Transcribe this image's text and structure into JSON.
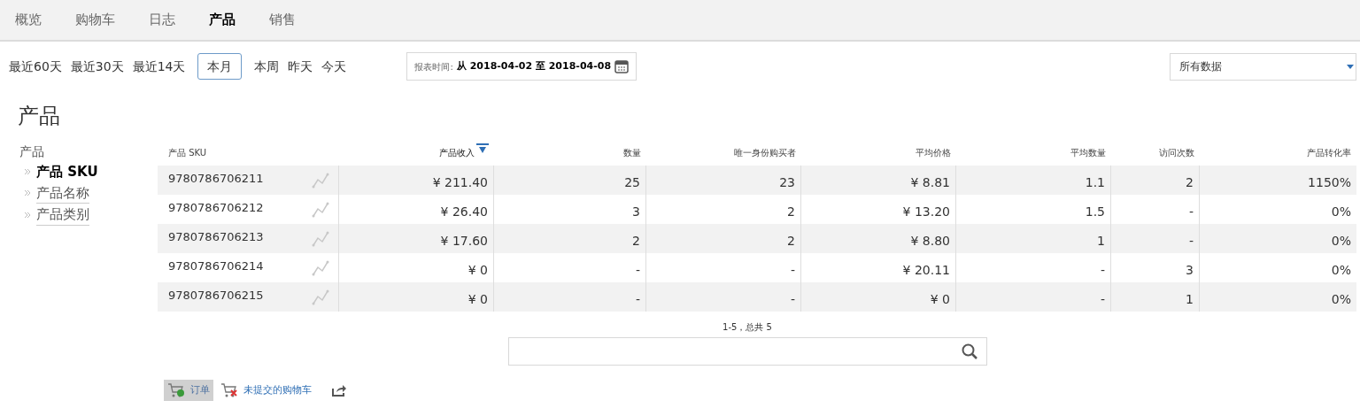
{
  "nav_tabs": [
    {
      "label": "概览",
      "selected": false
    },
    {
      "label": "购物车",
      "selected": false
    },
    {
      "label": "日志",
      "selected": false
    },
    {
      "label": "产品",
      "selected": true
    },
    {
      "label": "销售",
      "selected": false
    }
  ],
  "periods": [
    {
      "label": "最近60天",
      "selected": false
    },
    {
      "label": "最近30天",
      "selected": false
    },
    {
      "label": "最近14天",
      "selected": false
    },
    {
      "label": "本月",
      "selected": true
    },
    {
      "label": "本周",
      "selected": false
    },
    {
      "label": "昨天",
      "selected": false
    },
    {
      "label": "今天",
      "selected": false
    }
  ],
  "report_range": {
    "label": "报表时间:",
    "value": "从 2018-04-02 至 2018-04-08"
  },
  "segment_select": {
    "value": "所有数据"
  },
  "page_title": "产品",
  "sidebar": {
    "heading": "产品",
    "items": [
      {
        "label": "产品 SKU",
        "selected": true
      },
      {
        "label": "产品名称",
        "selected": false
      },
      {
        "label": "产品类别",
        "selected": false
      }
    ]
  },
  "table": {
    "columns": [
      {
        "label": "产品 SKU",
        "sorted": false
      },
      {
        "label": "产品收入",
        "sorted": true
      },
      {
        "label": "数量",
        "sorted": false
      },
      {
        "label": "唯一身份购买者",
        "sorted": false
      },
      {
        "label": "平均价格",
        "sorted": false
      },
      {
        "label": "平均数量",
        "sorted": false
      },
      {
        "label": "访问次数",
        "sorted": false
      },
      {
        "label": "产品转化率",
        "sorted": false
      }
    ],
    "rows": [
      [
        "9780786706211",
        "¥ 211.40",
        "25",
        "23",
        "¥ 8.81",
        "1.1",
        "2",
        "1150%"
      ],
      [
        "9780786706212",
        "¥ 26.40",
        "3",
        "2",
        "¥ 13.20",
        "1.5",
        "-",
        "0%"
      ],
      [
        "9780786706213",
        "¥ 17.60",
        "2",
        "2",
        "¥ 8.80",
        "1",
        "-",
        "0%"
      ],
      [
        "9780786706214",
        "¥ 0",
        "-",
        "-",
        "¥ 20.11",
        "-",
        "3",
        "0%"
      ],
      [
        "9780786706215",
        "¥ 0",
        "-",
        "-",
        "¥ 0",
        "-",
        "1",
        "0%"
      ]
    ]
  },
  "pagination": "1-5，总共 5",
  "bottom_tabs": [
    {
      "label": "订单",
      "kind": "orders",
      "selected": true
    },
    {
      "label": "未提交的购物车",
      "kind": "abandoned",
      "selected": false
    }
  ]
}
